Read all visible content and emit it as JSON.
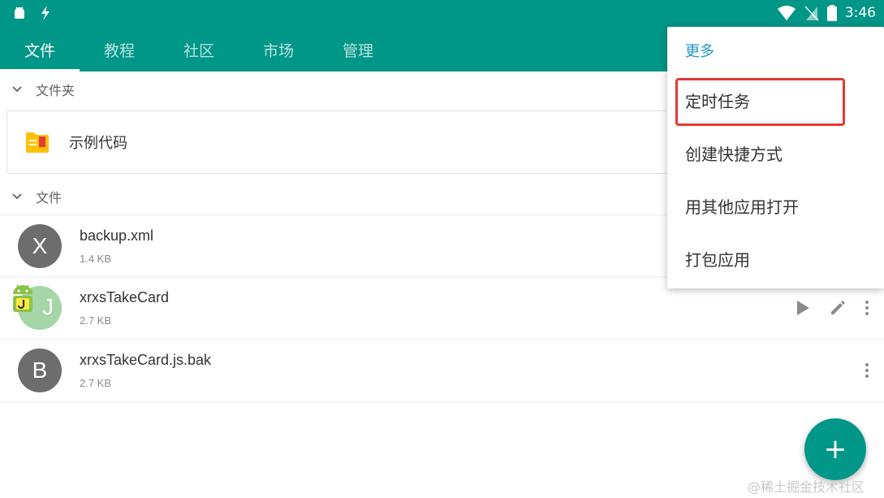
{
  "status_bar": {
    "time": "3:46",
    "left_icons": [
      "android-icon",
      "flash-icon"
    ],
    "right_icons": [
      "wifi-icon",
      "no-sim-icon",
      "battery-icon"
    ]
  },
  "tabs": [
    {
      "label": "文件",
      "active": true
    },
    {
      "label": "教程",
      "active": false
    },
    {
      "label": "社区",
      "active": false
    },
    {
      "label": "市场",
      "active": false
    },
    {
      "label": "管理",
      "active": false
    }
  ],
  "sections": {
    "folders": {
      "label": "文件夹"
    },
    "files": {
      "label": "文件"
    }
  },
  "folders": [
    {
      "name": "示例代码"
    }
  ],
  "files": [
    {
      "avatar": "X",
      "name": "backup.xml",
      "size": "1.4 KB"
    },
    {
      "avatar": "",
      "name": "xrxsTakeCard",
      "size": "2.7 KB"
    },
    {
      "avatar": "B",
      "name": "xrxsTakeCard.js.bak",
      "size": "2.7 KB"
    }
  ],
  "menu": {
    "header": "更多",
    "items": [
      {
        "label": "定时任务",
        "highlighted": true
      },
      {
        "label": "创建快捷方式"
      },
      {
        "label": "用其他应用打开"
      },
      {
        "label": "打包应用"
      }
    ]
  },
  "fab": {
    "symbol": "+"
  },
  "watermark": "@稀土掘金技术社区",
  "colors": {
    "primary": "#009688",
    "menu_header": "#1e96c8",
    "highlight": "#e53935"
  }
}
